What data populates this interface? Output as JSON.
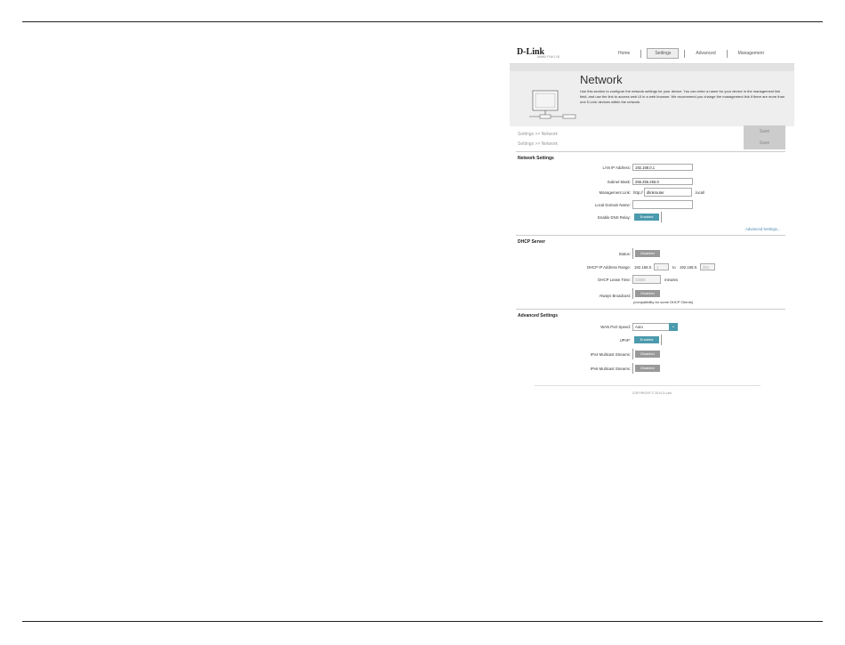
{
  "header": {
    "brand": "D-Link",
    "model": "M#W0  F/W:1.00",
    "nav": [
      {
        "label": "Home"
      },
      {
        "label": "Settings",
        "active": true
      },
      {
        "label": "Advanced"
      },
      {
        "label": "Management"
      }
    ]
  },
  "banner": {
    "title": "Network",
    "description": "Use this section to configure the network settings for your device. You can enter a name for your device in the management link field, and use the link to access web UI in a web browser. We recommend you change the management link if there are more than one D-Link devices within the network."
  },
  "breadcrumbs": [
    "Settings >> Network",
    "Settings >> Network"
  ],
  "save_labels": [
    "Save",
    "Save"
  ],
  "network_settings": {
    "header": "Network Settings",
    "lan_ip_label": "LAN IP Address:",
    "lan_ip_value": "192.168.0.1",
    "subnet_label": "Subnet Mask:",
    "subnet_value": "255.255.255.0",
    "mgmt_label": "Management Link:",
    "mgmt_prefix": "http://",
    "mgmt_value": "dlinkrouter",
    "mgmt_suffix": ".local/",
    "domain_label": "Local Domain Name:",
    "domain_value": "",
    "dns_relay_label": "Enable DNS Relay:",
    "dns_relay_state": "Enabled",
    "advanced_link": "Advanced Settings..."
  },
  "dhcp": {
    "header": "DHCP Server",
    "status_label": "Status:",
    "status_state": "Disabled",
    "range_label": "DHCP IP Address Range:",
    "range_prefix1": "192.168.0.",
    "range_start": "1",
    "range_to": "to",
    "range_prefix2": "192.168.0.",
    "range_end": "254",
    "lease_label": "DHCP Lease Time:",
    "lease_value": "10080",
    "lease_unit": "minutes",
    "broadcast_label": "Always Broadcast:",
    "broadcast_state": "Disabled",
    "broadcast_note": "(compatibility for some DHCP Clients)"
  },
  "advanced": {
    "header": "Advanced Settings",
    "wan_label": "WAN Port Speed:",
    "wan_value": "Auto",
    "upnp_label": "UPnP:",
    "upnp_state": "Enabled",
    "ipv4_label": "IPv4 Multicast Streams:",
    "ipv4_state": "Disabled",
    "ipv6_label": "IPv6 Multicast Streams:",
    "ipv6_state": "Disabled"
  },
  "footer": {
    "copyright": "COPYRIGHT © 2014 D-Link"
  },
  "colors": {
    "accent": "#4b9aad",
    "disabled": "#999999"
  }
}
